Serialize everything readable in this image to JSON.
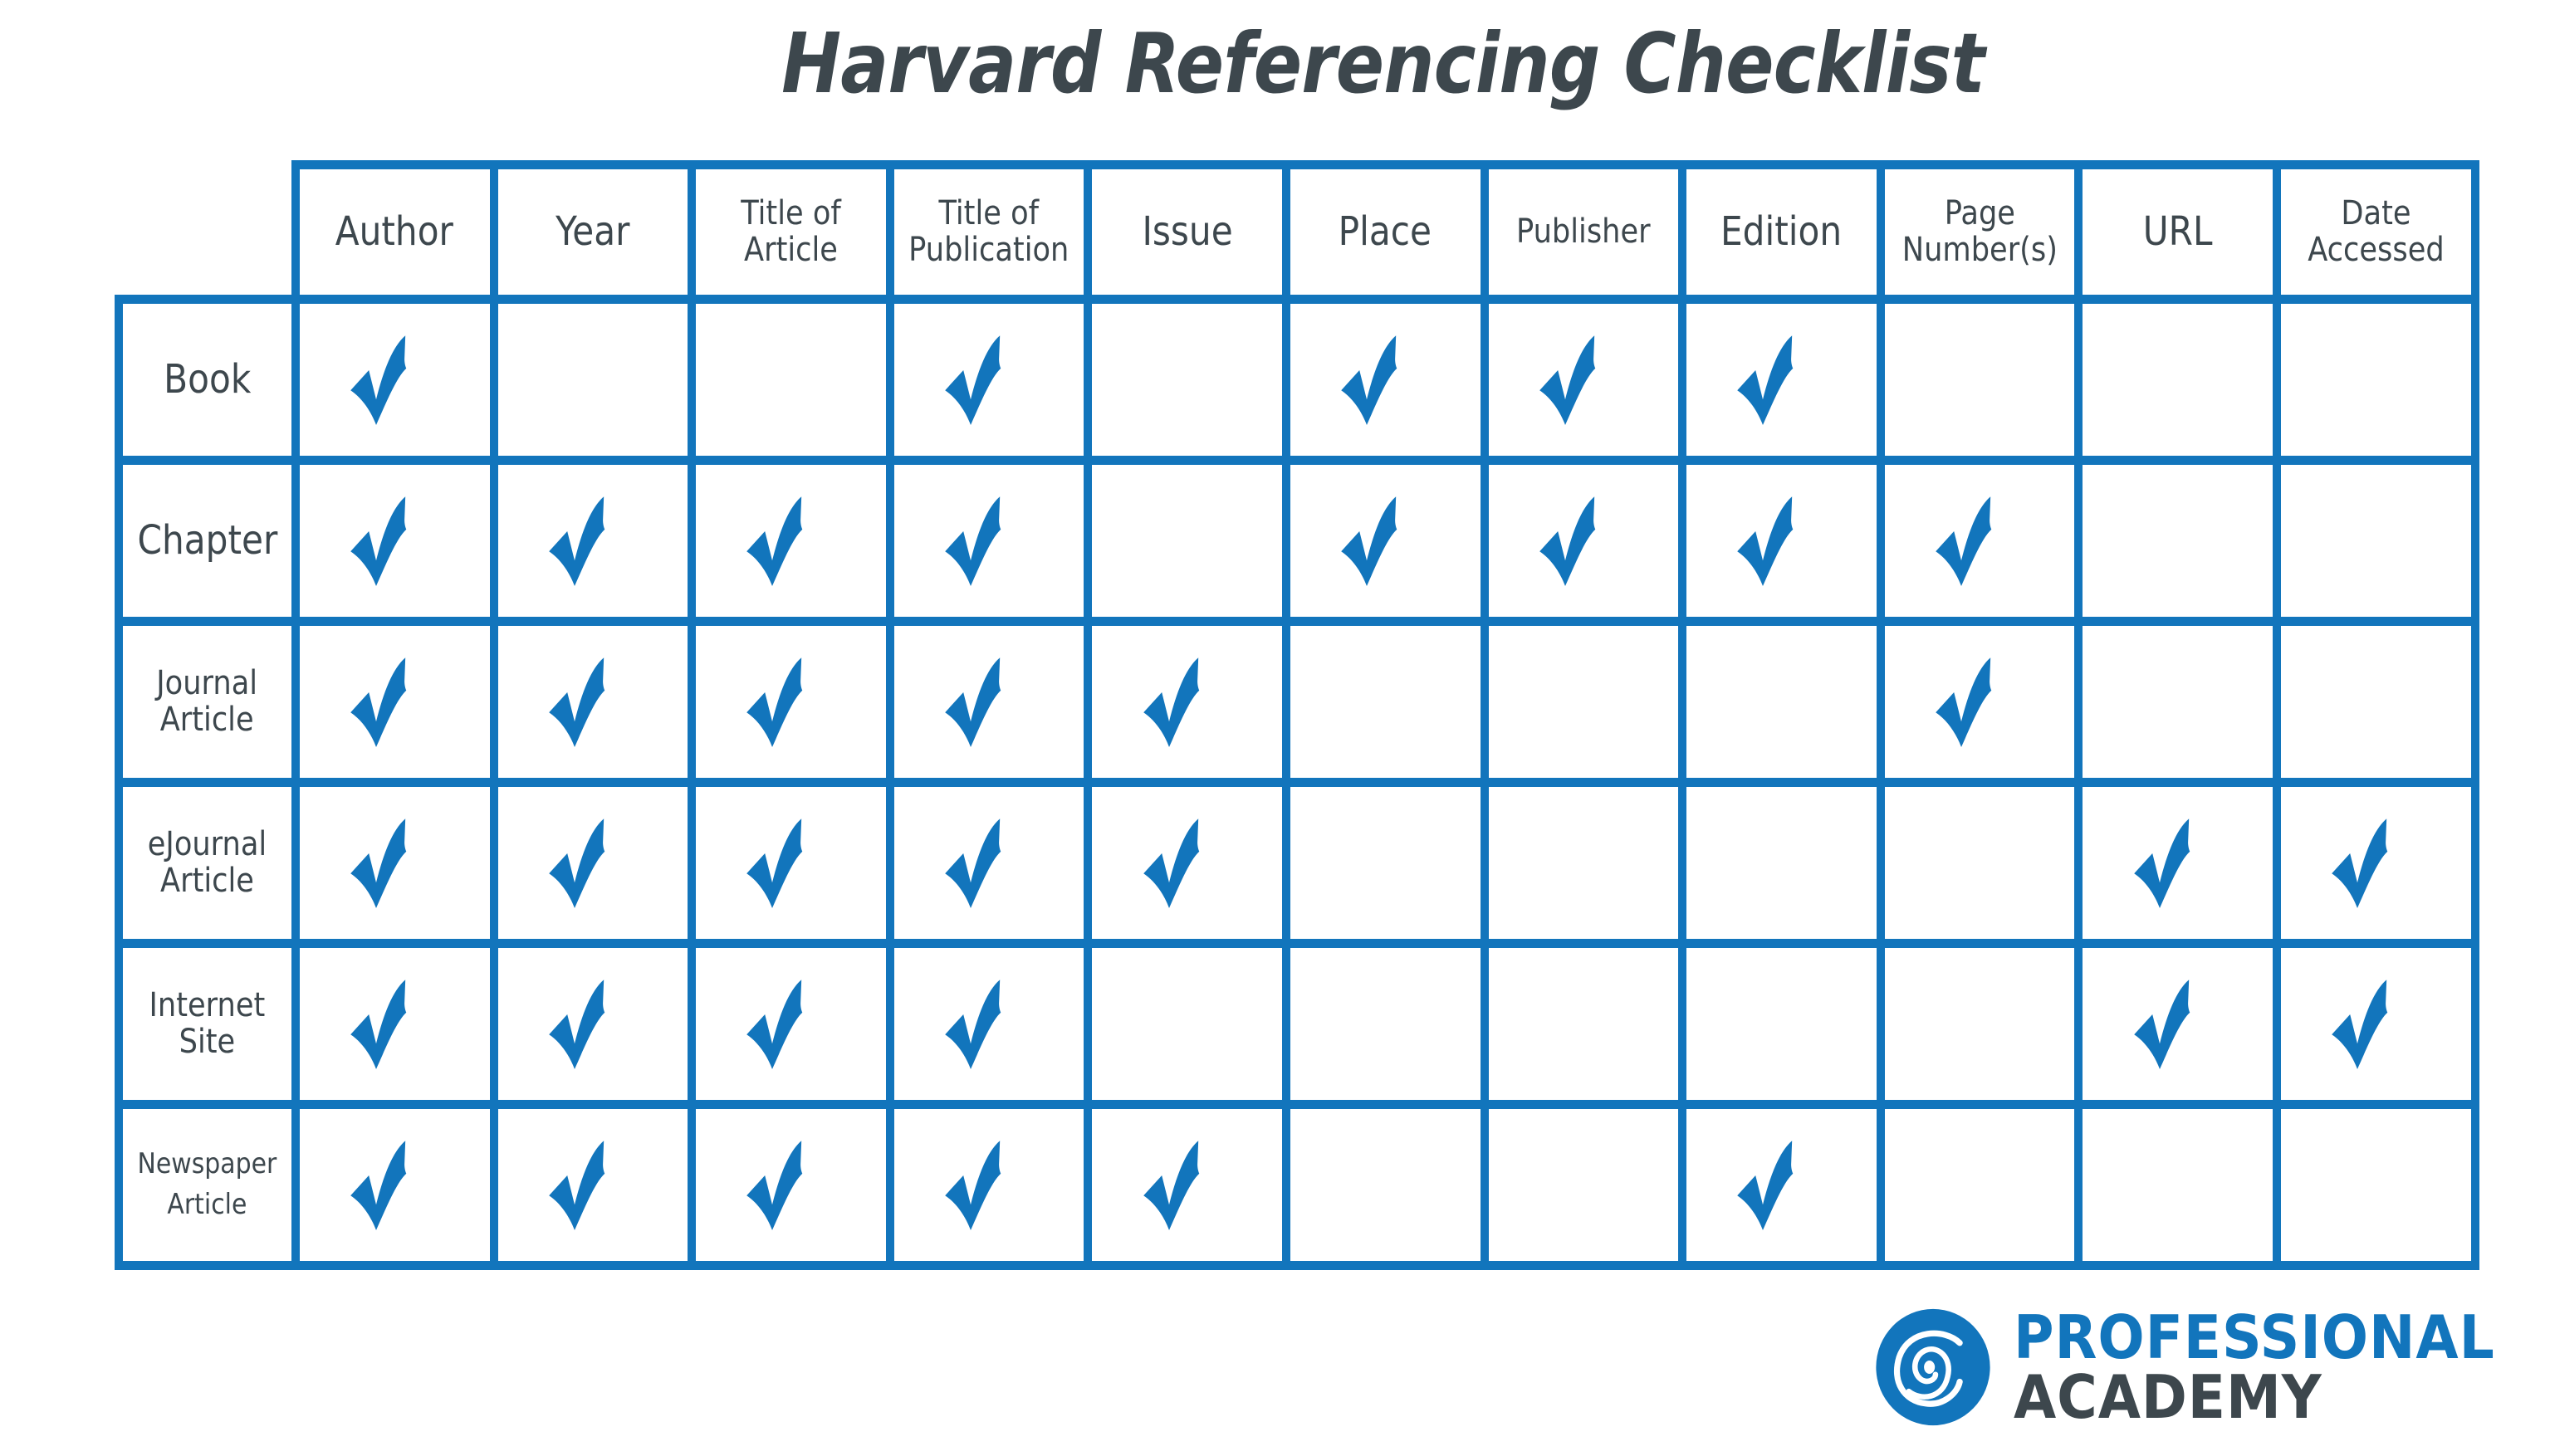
{
  "title": "Harvard Referencing Checklist",
  "colors": {
    "accent": "#1275bc",
    "text": "#3d474d",
    "background": "#ffffff"
  },
  "columns": [
    {
      "label": "Author"
    },
    {
      "label": "Year"
    },
    {
      "label": "Title of\nArticle"
    },
    {
      "label": "Title of\nPublication"
    },
    {
      "label": "Issue"
    },
    {
      "label": "Place"
    },
    {
      "label": "Publisher"
    },
    {
      "label": "Edition"
    },
    {
      "label": "Page\nNumber(s)"
    },
    {
      "label": "URL"
    },
    {
      "label": "Date\nAccessed"
    }
  ],
  "rows": [
    {
      "label": "Book",
      "checks": [
        1,
        0,
        0,
        1,
        0,
        1,
        1,
        1,
        0,
        0,
        0
      ]
    },
    {
      "label": "Chapter",
      "checks": [
        1,
        1,
        1,
        1,
        0,
        1,
        1,
        1,
        1,
        0,
        0
      ]
    },
    {
      "label": "Journal\nArticle",
      "checks": [
        1,
        1,
        1,
        1,
        1,
        0,
        0,
        0,
        1,
        0,
        0
      ]
    },
    {
      "label": "eJournal\nArticle",
      "checks": [
        1,
        1,
        1,
        1,
        1,
        0,
        0,
        0,
        0,
        1,
        1
      ]
    },
    {
      "label": "Internet\nSite",
      "checks": [
        1,
        1,
        1,
        1,
        0,
        0,
        0,
        0,
        0,
        1,
        1
      ]
    },
    {
      "label": "Newspaper\nArticle",
      "checks": [
        1,
        1,
        1,
        1,
        1,
        0,
        0,
        1,
        0,
        0,
        0
      ]
    }
  ],
  "check_icon": "check-mark-icon",
  "logo": {
    "line1": "PROFESSIONAL",
    "line2": "ACADEMY",
    "icon": "spiral-logo-icon"
  }
}
